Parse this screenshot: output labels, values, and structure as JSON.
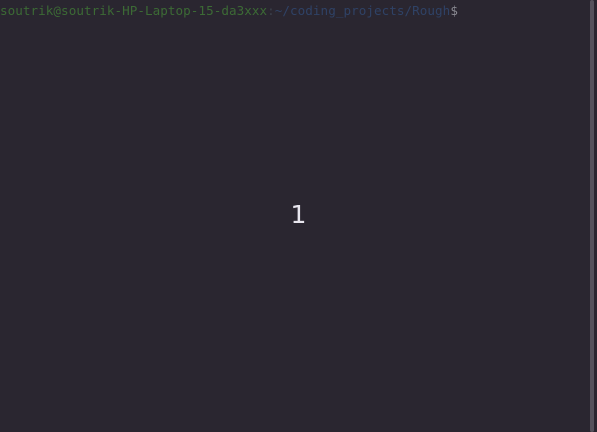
{
  "terminal": {
    "prompt": {
      "user_host": "soutrik@soutrik-HP-Laptop-15-da3xxx",
      "separator": ":",
      "path": "~/coding_projects/Rough",
      "symbol": "$"
    },
    "output": "1"
  },
  "colors": {
    "background": "#2a2630",
    "user_host": "#3c6a35",
    "path": "#2f4266",
    "text": "#e8e6ee"
  }
}
